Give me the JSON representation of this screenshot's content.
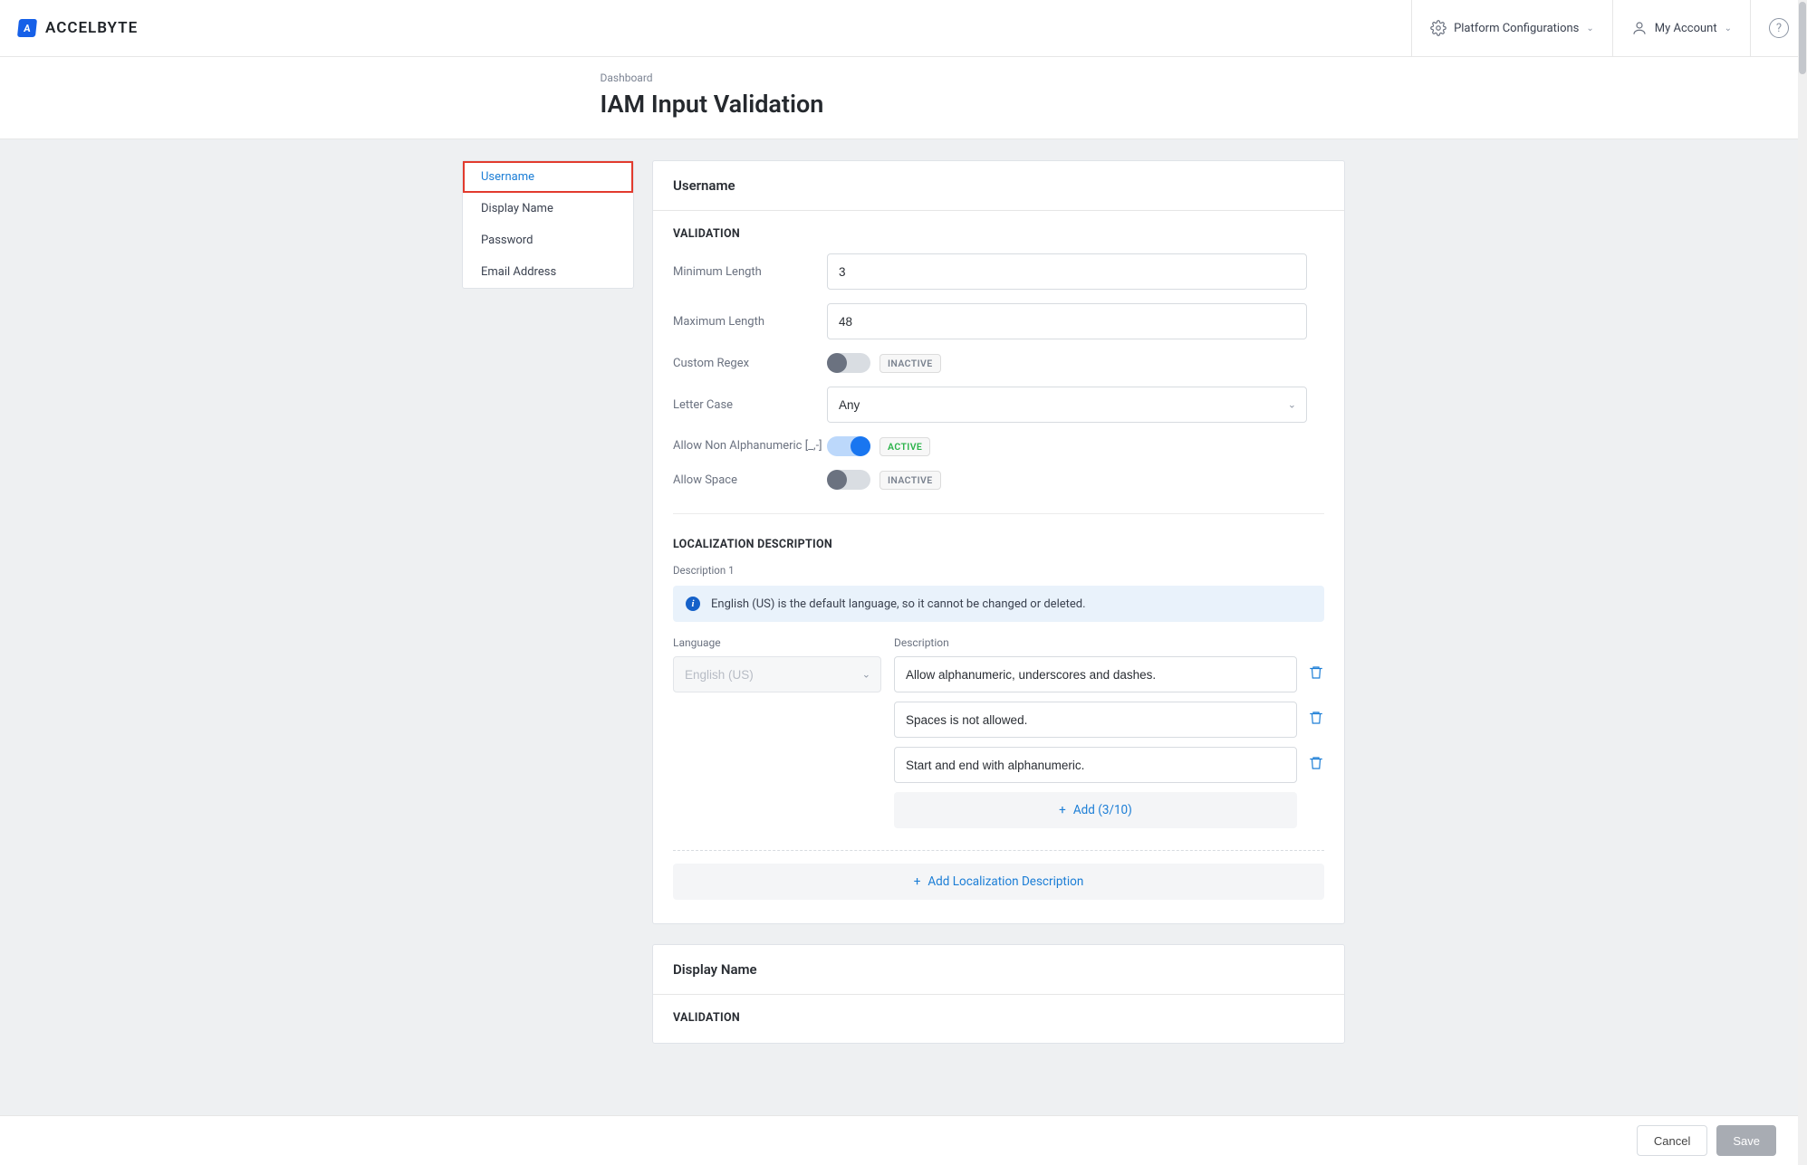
{
  "brand": {
    "name": "ACCELBYTE"
  },
  "header": {
    "platform_config": "Platform Configurations",
    "my_account": "My Account"
  },
  "breadcrumb": "Dashboard",
  "page_title": "IAM Input Validation",
  "sidenav": {
    "items": [
      {
        "label": "Username",
        "active": true
      },
      {
        "label": "Display Name"
      },
      {
        "label": "Password"
      },
      {
        "label": "Email Address"
      }
    ]
  },
  "section_username": {
    "title": "Username",
    "validation_title": "VALIDATION",
    "fields": {
      "min_len_label": "Minimum Length",
      "min_len_value": "3",
      "max_len_label": "Maximum Length",
      "max_len_value": "48",
      "custom_regex_label": "Custom Regex",
      "custom_regex_state": "INACTIVE",
      "letter_case_label": "Letter Case",
      "letter_case_value": "Any",
      "allow_non_alnum_label": "Allow Non Alphanumeric [_,-]",
      "allow_non_alnum_state": "ACTIVE",
      "allow_space_label": "Allow Space",
      "allow_space_state": "INACTIVE"
    },
    "localization": {
      "title": "LOCALIZATION DESCRIPTION",
      "desc_heading": "Description 1",
      "info": "English (US) is the default language, so it cannot be changed or deleted.",
      "lang_label": "Language",
      "lang_value": "English (US)",
      "desc_label": "Description",
      "lines": [
        "Allow alphanumeric, underscores and dashes.",
        "Spaces is not allowed.",
        "Start and end with alphanumeric."
      ],
      "add_line": "Add (3/10)",
      "add_loc": "Add Localization Description"
    }
  },
  "section_display_name": {
    "title": "Display Name",
    "validation_title": "VALIDATION"
  },
  "footer": {
    "cancel": "Cancel",
    "save": "Save"
  }
}
